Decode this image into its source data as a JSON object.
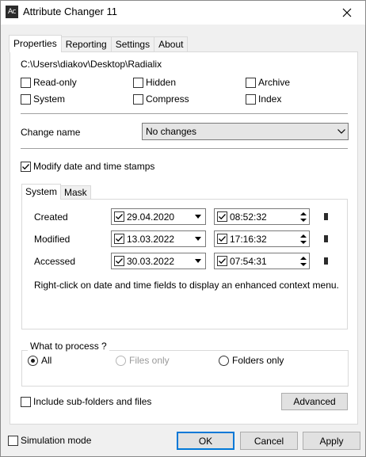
{
  "window": {
    "title": "Attribute Changer 11",
    "app_icon_text": "Ac"
  },
  "tabs": [
    {
      "label": "Properties",
      "active": true
    },
    {
      "label": "Reporting",
      "active": false
    },
    {
      "label": "Settings",
      "active": false
    },
    {
      "label": "About",
      "active": false
    }
  ],
  "properties": {
    "path": "C:\\Users\\diakov\\Desktop\\Radialix",
    "attributes": {
      "readonly": {
        "label": "Read-only",
        "checked": false
      },
      "hidden": {
        "label": "Hidden",
        "checked": false
      },
      "archive": {
        "label": "Archive",
        "checked": false
      },
      "system": {
        "label": "System",
        "checked": false
      },
      "compress": {
        "label": "Compress",
        "checked": false
      },
      "index": {
        "label": "Index",
        "checked": false
      }
    },
    "change_name": {
      "label": "Change name",
      "value": "No changes"
    },
    "modify_dates": {
      "label": "Modify date and time stamps",
      "checked": true
    },
    "date_tabs": [
      {
        "label": "System",
        "active": true
      },
      {
        "label": "Mask",
        "active": false
      }
    ],
    "dates": {
      "created": {
        "label": "Created",
        "date": "29.04.2020",
        "time": "08:52:32",
        "date_checked": true,
        "time_checked": true
      },
      "modified": {
        "label": "Modified",
        "date": "13.03.2022",
        "time": "17:16:32",
        "date_checked": true,
        "time_checked": true
      },
      "accessed": {
        "label": "Accessed",
        "date": "30.03.2022",
        "time": "07:54:31",
        "date_checked": true,
        "time_checked": true
      }
    },
    "hint": "Right-click on date and time fields to display an enhanced context menu.",
    "process": {
      "legend": "What to process ?",
      "all": {
        "label": "All",
        "selected": true
      },
      "files": {
        "label": "Files only",
        "selected": false,
        "disabled": true
      },
      "folders": {
        "label": "Folders only",
        "selected": false
      }
    },
    "include_subfolders": {
      "label": "Include sub-folders and files",
      "checked": false
    },
    "advanced_label": "Advanced"
  },
  "footer": {
    "simulation": {
      "label": "Simulation mode",
      "checked": false
    },
    "ok_label": "OK",
    "cancel_label": "Cancel",
    "apply_label": "Apply"
  }
}
